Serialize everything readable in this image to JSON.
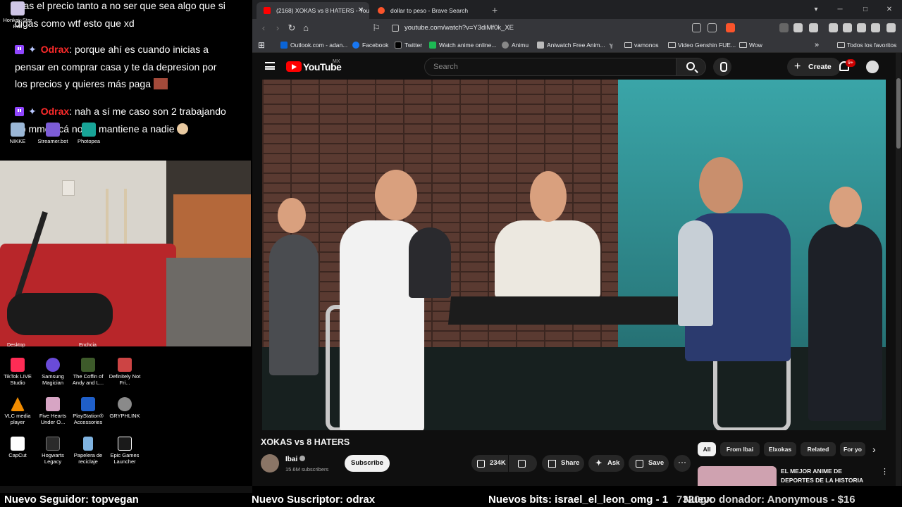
{
  "stream_chat": {
    "messages": [
      {
        "user": "",
        "text": "aras el precio tanto a no ser que sea algo que si digas como wtf esto que xd"
      },
      {
        "user": "Odrax",
        "text": ": porque ahí es cuando inicias a pensar en comprar casa y te da depresion por los precios y quieres más paga"
      },
      {
        "user": "Odrax",
        "text": ": nah a sí me caso son 2 trabajando no mmo acá no se mantiene a nadie"
      }
    ]
  },
  "desktop_top_icons": [
    {
      "label": "Honkai: Star Rail",
      "icon": "app-icon"
    },
    {
      "label": "NIKKE",
      "icon": "app-icon"
    },
    {
      "label": "Streamer.bot",
      "icon": "app-icon"
    },
    {
      "label": "Photopea",
      "icon": "app-icon"
    }
  ],
  "desktop_partial_labels": [
    "Desktop",
    "Enchcia"
  ],
  "desktop_icons": [
    {
      "label": "TikTok LIVE Studio",
      "icon": "tiktok-icon",
      "color": "#fe2c55"
    },
    {
      "label": "Samsung Magician",
      "icon": "samsung-icon",
      "color": "#6a4bd8"
    },
    {
      "label": "The Coffin of Andy and L...",
      "icon": "game-icon",
      "color": "#3d5a2a"
    },
    {
      "label": "Definitely Not Fri...",
      "icon": "game-icon",
      "color": "#c44"
    },
    {
      "label": "VLC media player",
      "icon": "vlc-icon",
      "color": "#f28c00"
    },
    {
      "label": "Five Hearts Under O...",
      "icon": "game-icon",
      "color": "#d7a5c4"
    },
    {
      "label": "PlayStation® Accessories",
      "icon": "playstation-icon",
      "color": "#1f5fc9"
    },
    {
      "label": "GRYPHLINK",
      "icon": "gryphlink-icon",
      "color": "#8a8a8a"
    },
    {
      "label": "CapCut",
      "icon": "capcut-icon",
      "color": "#ffffff"
    },
    {
      "label": "Hogwarts Legacy",
      "icon": "game-icon",
      "color": "#2b2b2b"
    },
    {
      "label": "Papelera de reciclaje",
      "icon": "recycle-bin-icon",
      "color": "#7fb3e0"
    },
    {
      "label": "Epic Games Launcher",
      "icon": "epic-icon",
      "color": "#1a1a1a"
    }
  ],
  "browser": {
    "tabs": [
      {
        "title": "(2168) XOKAS vs 8 HATERS - You",
        "active": true,
        "icon": "youtube-favicon"
      },
      {
        "title": "dollar to peso - Brave Search",
        "active": false,
        "icon": "brave-favicon"
      }
    ],
    "new_tab_label": "+",
    "window_controls": [
      "▾",
      "─",
      "□",
      "✕"
    ],
    "url": "youtube.com/watch?v=Y3diMf0k_XE",
    "bookmarks": [
      {
        "label": "Outlook.com - adan...",
        "icon": "outlook-icon",
        "color": "#0a64d6"
      },
      {
        "label": "Facebook",
        "icon": "facebook-icon",
        "color": "#1877f2"
      },
      {
        "label": "Twitter",
        "icon": "x-icon",
        "color": "#000000"
      },
      {
        "label": "Watch anime online...",
        "icon": "bookmark-icon",
        "color": "#1db954"
      },
      {
        "label": "Animu",
        "icon": "globe-icon",
        "color": "#888888"
      },
      {
        "label": "Aniwatch Free Anim...",
        "icon": "bookmark-icon",
        "color": "#bbbbbb"
      },
      {
        "label": "vamonos",
        "icon": "folder-icon",
        "color": ""
      },
      {
        "label": "Video Genshin FUE...",
        "icon": "folder-icon",
        "color": ""
      },
      {
        "label": "Wow",
        "icon": "folder-icon",
        "color": ""
      }
    ],
    "bookmarks_overflow": "»",
    "all_bookmarks": "Todos los favoritos"
  },
  "youtube": {
    "logo_text": "YouTube",
    "region": "MX",
    "search_placeholder": "Search",
    "create_label": "Create",
    "notifications": "9+",
    "video_title": "XOKAS vs 8 HATERS",
    "channel": {
      "name": "Ibai",
      "subscribers": "15.6M subscribers"
    },
    "subscribe_label": "Subscribe",
    "likes": "234K",
    "share_label": "Share",
    "ask_label": "Ask",
    "save_label": "Save",
    "more_label": "···",
    "chips": [
      "All",
      "From Ibai",
      "Elxokas",
      "Related",
      "For yo"
    ],
    "recommended": [
      {
        "title": "EL MEJOR ANIME DE DEPORTES DE LA HISTORIA"
      }
    ]
  },
  "ticker": {
    "follower": "Nuevo Seguidor: topvegan",
    "subscriber": "Nuevo Suscriptor: odrax",
    "bits": "Nuevos bits: israel_el_leon_omg - 1",
    "donation": "Nuevo donador: Anonymous - $16",
    "overlap_text": "7320gx"
  },
  "colors": {
    "youtube_red": "#ff0000",
    "twitch_purple": "#9146ff",
    "chat_username": "#ff2b2b",
    "browser_chrome": "#35363a"
  }
}
